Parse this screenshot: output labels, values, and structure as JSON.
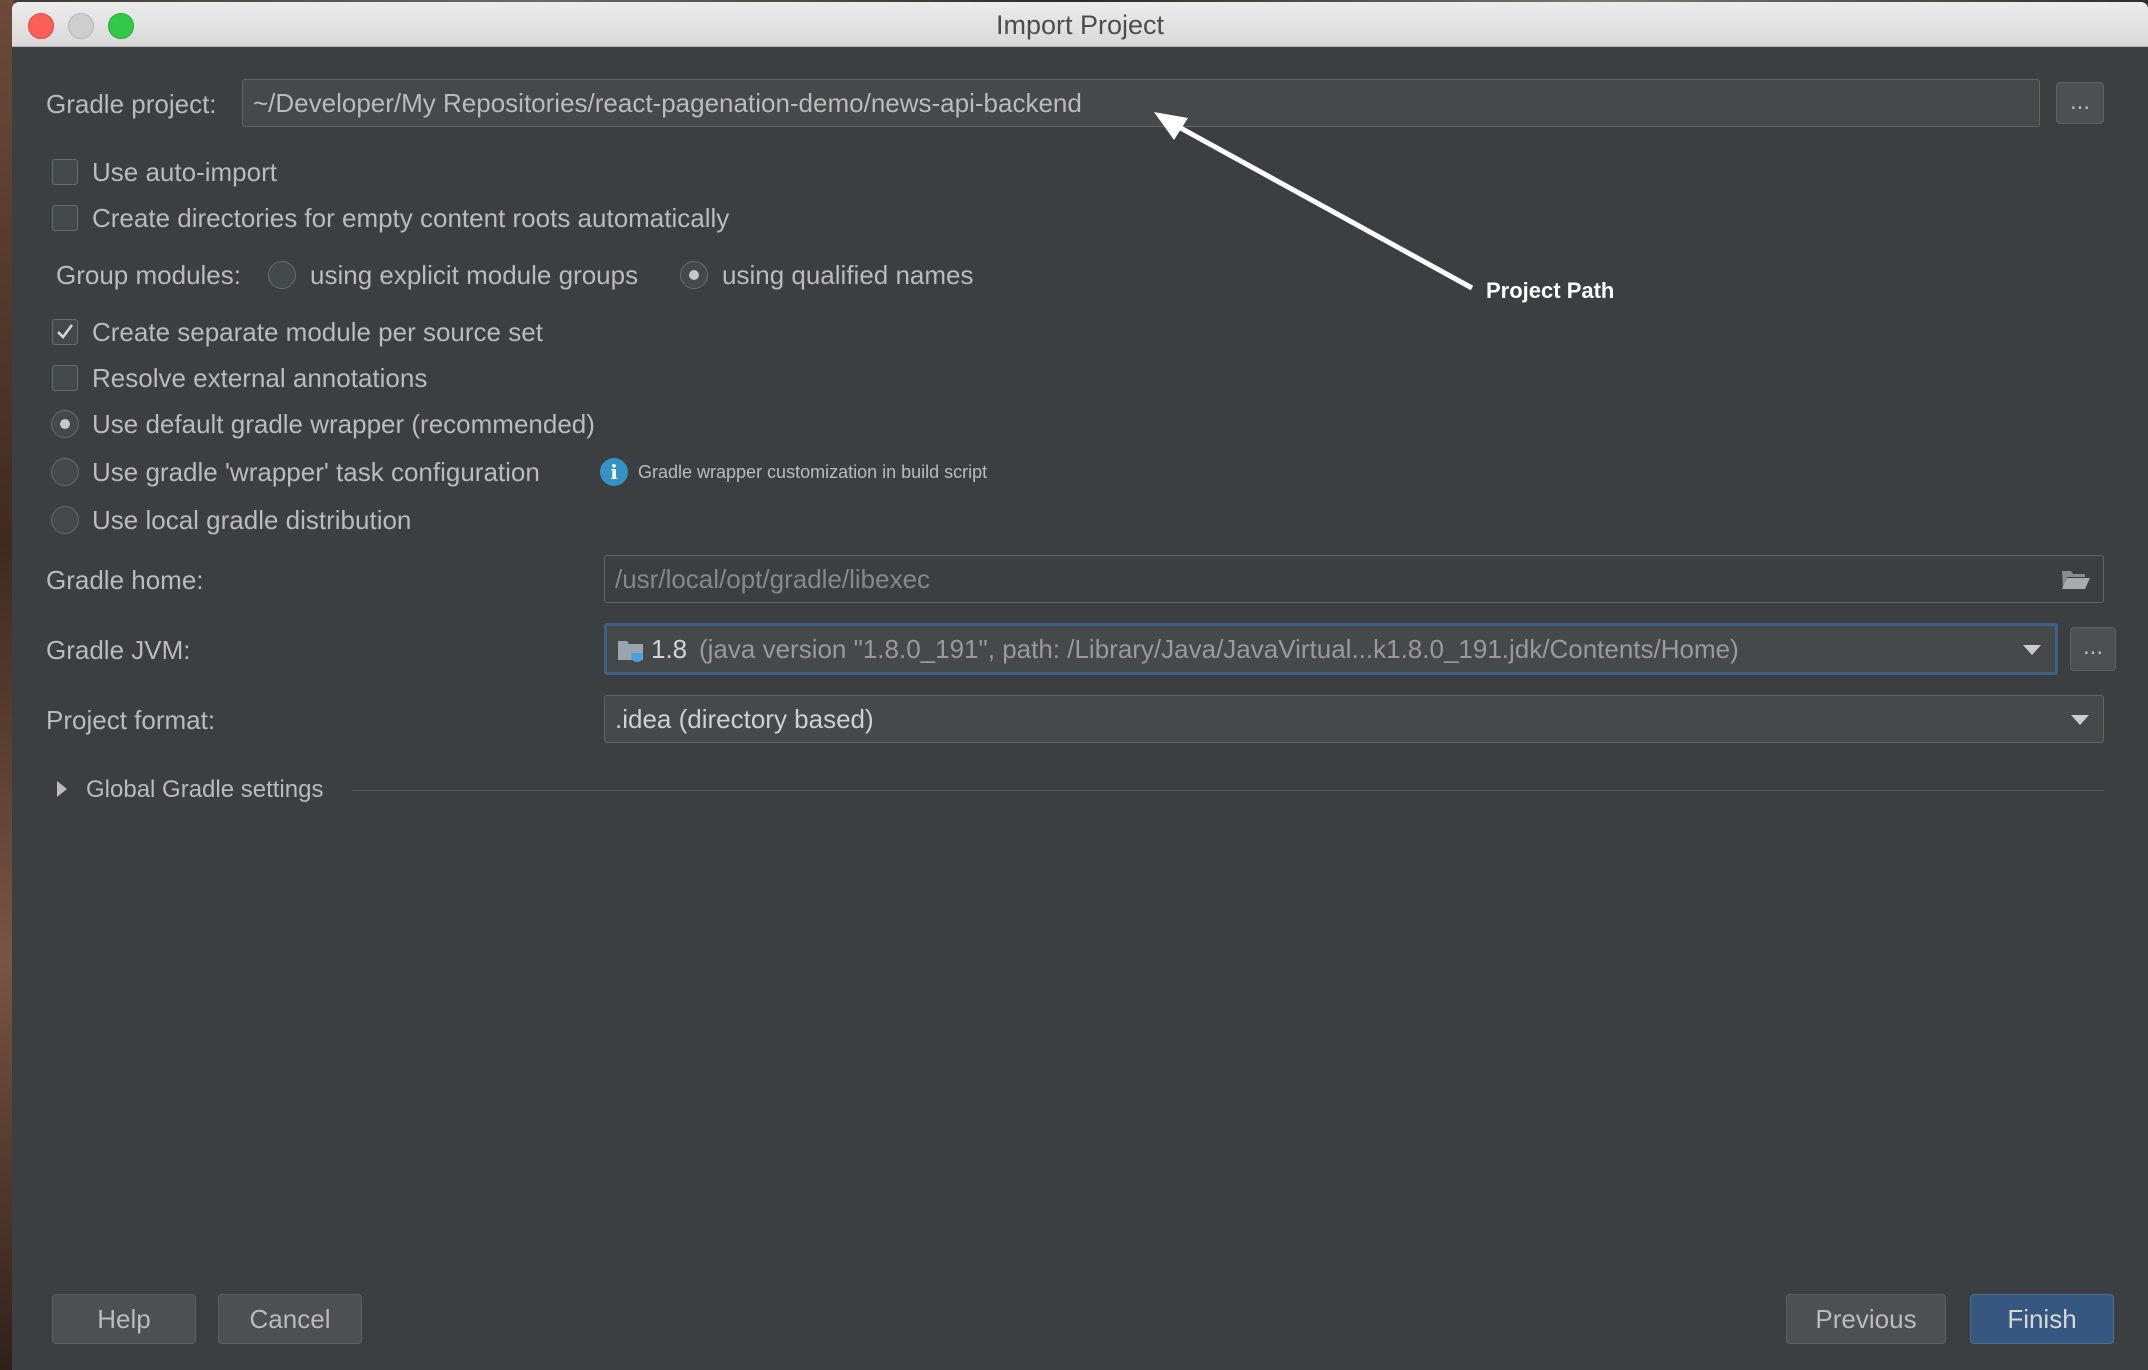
{
  "window": {
    "title": "Import Project"
  },
  "gradle_project": {
    "label": "Gradle project:",
    "value": "~/Developer/My Repositories/react-pagenation-demo/news-api-backend",
    "browse_label": "..."
  },
  "options": {
    "auto_import": {
      "label": "Use auto-import",
      "checked": false
    },
    "create_dirs": {
      "label": "Create directories for empty content roots automatically",
      "checked": false
    },
    "group_modules": {
      "label": "Group modules:",
      "explicit": {
        "label": "using explicit module groups",
        "selected": false
      },
      "qualified": {
        "label": "using qualified names",
        "selected": true
      }
    },
    "separate_module": {
      "label": "Create separate module per source set",
      "checked": true
    },
    "resolve_annotations": {
      "label": "Resolve external annotations",
      "checked": false
    },
    "default_wrapper": {
      "label": "Use default gradle wrapper (recommended)",
      "selected": true
    },
    "wrapper_task": {
      "label": "Use gradle 'wrapper' task configuration",
      "selected": false
    },
    "wrapper_info": "Gradle wrapper customization in build script",
    "local_distribution": {
      "label": "Use local gradle distribution",
      "selected": false
    }
  },
  "gradle_home": {
    "label": "Gradle home:",
    "value": "/usr/local/opt/gradle/libexec"
  },
  "gradle_jvm": {
    "label": "Gradle JVM:",
    "version": "1.8",
    "detail": "(java version \"1.8.0_191\", path: /Library/Java/JavaVirtual...k1.8.0_191.jdk/Contents/Home)",
    "browse_label": "..."
  },
  "project_format": {
    "label": "Project format:",
    "value": ".idea (directory based)"
  },
  "global_settings": {
    "label": "Global Gradle settings"
  },
  "annotation": {
    "label": "Project Path"
  },
  "buttons": {
    "help": "Help",
    "cancel": "Cancel",
    "previous": "Previous",
    "finish": "Finish"
  },
  "colors": {
    "background": "#3c3f41",
    "primary_button": "#365880",
    "focus_border": "#3d6185",
    "info_icon": "#3592c4"
  },
  "icons": {
    "browse": "ellipsis-icon",
    "folder": "folder-open-icon",
    "jdk": "jdk-folder-icon",
    "info": "info-icon",
    "expand": "triangle-right-icon"
  }
}
